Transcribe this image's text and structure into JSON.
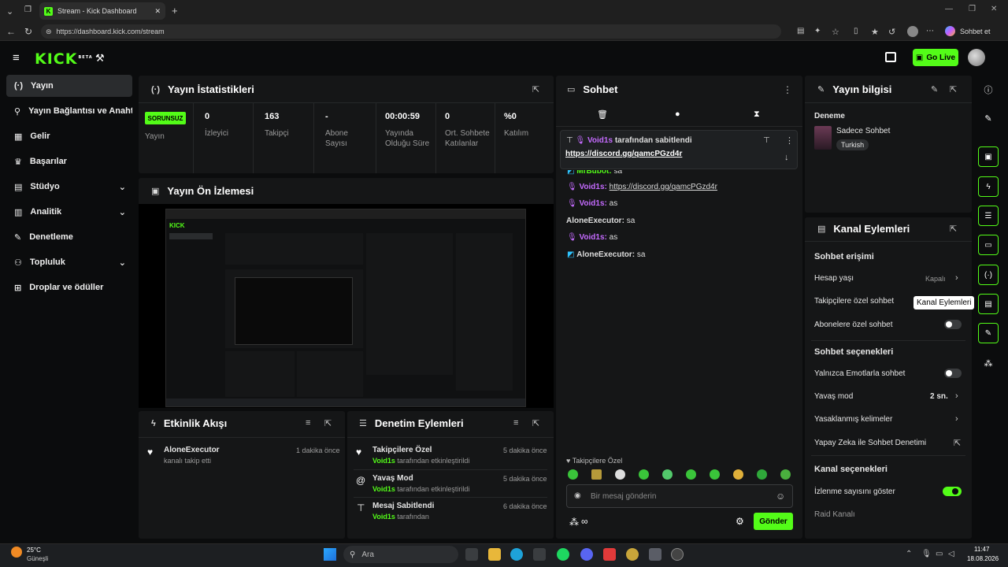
{
  "browser": {
    "tab_title": "Stream - Kick Dashboard",
    "url": "https://dashboard.kick.com/stream",
    "profile_label": "Sohbet et"
  },
  "header": {
    "logo": "KICK",
    "logo_badge": "BETA",
    "go_live": "Go Live"
  },
  "sidebar": {
    "items": [
      {
        "label": "Yayın",
        "icon": "broadcast-icon"
      },
      {
        "label": "Yayın Bağlantısı ve Anahtarı",
        "icon": "link-icon"
      },
      {
        "label": "Gelir",
        "icon": "revenue-icon"
      },
      {
        "label": "Başarılar",
        "icon": "trophy-icon"
      },
      {
        "label": "Stüdyo",
        "icon": "studio-icon"
      },
      {
        "label": "Analitik",
        "icon": "analytics-icon"
      },
      {
        "label": "Denetleme",
        "icon": "wrench-icon"
      },
      {
        "label": "Topluluk",
        "icon": "community-icon"
      },
      {
        "label": "Droplar ve ödüller",
        "icon": "gift-icon"
      }
    ]
  },
  "stats": {
    "title": "Yayın İstatistikleri",
    "status": "SORUNSUZ",
    "status_label": "Yayın",
    "items": [
      {
        "value": "0",
        "label": "İzleyici"
      },
      {
        "value": "163",
        "label": "Takipçi"
      },
      {
        "value": "-",
        "label": "Abone Sayısı"
      },
      {
        "value": "00:00:59",
        "label": "Yayında Olduğu Süre"
      },
      {
        "value": "0",
        "label": "Ort. Sohbete Katılanlar"
      },
      {
        "value": "%0",
        "label": "Katılım"
      }
    ]
  },
  "preview": {
    "title": "Yayın Ön İzlemesi"
  },
  "activity": {
    "title": "Etkinlik Akışı",
    "items": [
      {
        "name": "AloneExecutor",
        "text": "kanalı takip etti",
        "time": "1 dakika önce"
      }
    ]
  },
  "moderation": {
    "title": "Denetim Eylemleri",
    "items": [
      {
        "title": "Takipçilere Özel",
        "by": "Void1s",
        "text": "tarafından etkinleştirildi",
        "time": "5 dakika önce"
      },
      {
        "title": "Yavaş Mod",
        "by": "Void1s",
        "text": "tarafından etkinleştirildi",
        "time": "5 dakika önce"
      },
      {
        "title": "Mesaj Sabitlendi",
        "by": "Void1s",
        "text": "tarafından",
        "time": "6 dakika önce"
      }
    ]
  },
  "chat": {
    "title": "Sohbet",
    "pinned": {
      "user": "Void1s",
      "by_text": "tarafından sabitlendi",
      "link": "https://discord.gg/qamcPGzd4r"
    },
    "messages": [
      {
        "user": "MrBubot:",
        "text": "sa"
      },
      {
        "user": "Void1s:",
        "text": "https://discord.gg/qamcPGzd4r"
      },
      {
        "user": "Void1s:",
        "text": "as"
      },
      {
        "user": "AloneExecutor:",
        "text": "sa"
      },
      {
        "user": "Void1s:",
        "text": "as"
      },
      {
        "user": "AloneExecutor:",
        "text": "sa"
      }
    ],
    "mode_label": "Takipçilere Özel",
    "input_placeholder": "Bir mesaj gönderin",
    "send": "Gönder"
  },
  "info": {
    "title": "Yayın bilgisi",
    "stream_title": "Deneme",
    "category": "Sadece Sohbet",
    "tag": "Turkish"
  },
  "channel": {
    "title": "Kanal Eylemleri",
    "chat_access": "Sohbet erişimi",
    "account_age": "Hesap yaşı",
    "account_age_value": "Kapalı",
    "followers_only": "Takipçilere özel sohbet",
    "subs_only": "Abonelere özel sohbet",
    "chat_options": "Sohbet seçenekleri",
    "emotes_only": "Yalnızca Emotlarla sohbet",
    "slow_mode": "Yavaş mod",
    "slow_mode_value": "2 sn.",
    "banned_words": "Yasaklanmış kelimeler",
    "ai_mod": "Yapay Zeka ile Sohbet Denetimi",
    "channel_options": "Kanal seçenekleri",
    "show_viewers": "İzlenme sayısını göster",
    "raid": "Raid Kanalı",
    "tooltip": "Kanal Eylemleri"
  },
  "taskbar": {
    "weather_temp": "25°C",
    "weather_text": "Güneşli",
    "search": "Ara",
    "time": "11:47",
    "date": "18.08.2026"
  },
  "colors": {
    "accent": "#53fc18",
    "purple": "#c56bff",
    "panel": "#151617"
  }
}
